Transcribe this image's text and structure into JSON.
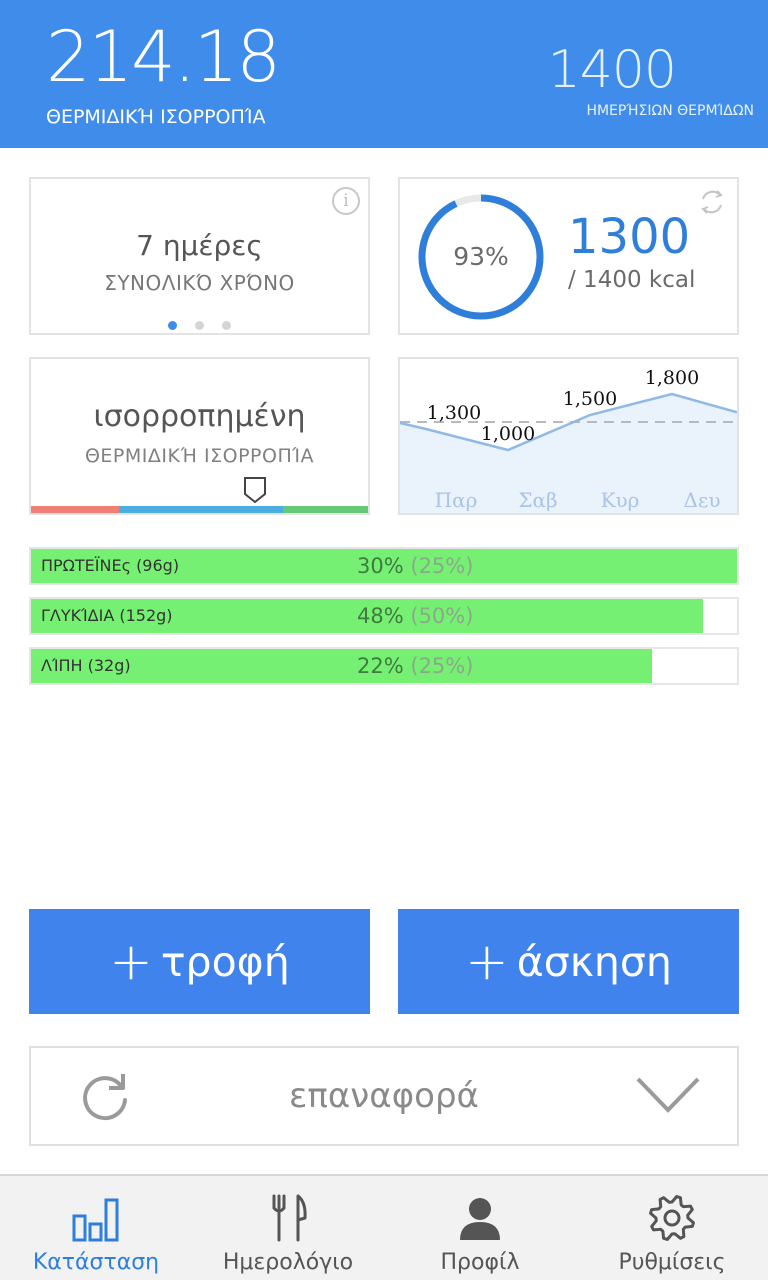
{
  "header": {
    "balance_value": "214.18",
    "balance_label": "ΘΕΡΜΙΔΙΚΉ ΙΣΟΡΡΟΠΊΑ",
    "daily_value": "1400",
    "daily_label": "ΗΜΕΡΉΣΙΩΝ ΘΕΡΜΊΔΩΝ"
  },
  "days_card": {
    "value": "7 ημέρες",
    "label": "ΣΥΝΟΛΙΚΌ ΧΡΌΝΟ",
    "info_icon": "info-icon",
    "page_count": 3,
    "active_page": 0
  },
  "calorie_card": {
    "percent_label": "93%",
    "percent": 0.93,
    "value": "1300",
    "goal": "/ 1400 kcal",
    "sync_icon": "sync-icon",
    "ring_color": "#2f7fda"
  },
  "status_card": {
    "value": "ισορροπημένη",
    "label": "ΘΕΡΜΙΔΙΚΉ ΙΣΟΡΡΟΠΊΑ",
    "scale_colors": [
      "#ef7f72",
      "#4aaee3",
      "#66c777"
    ],
    "marker_position": 0.66
  },
  "chart_data": {
    "type": "line",
    "categories": [
      "Παρ",
      "Σαβ",
      "Κυρ",
      "Δευ"
    ],
    "values": [
      1300,
      1000,
      1500,
      1800
    ],
    "data_labels": [
      "1,300",
      "1,000",
      "1,500",
      "1,800"
    ],
    "reference_value": 1400,
    "line_color": "#8fb9e6",
    "fill_color": "#eaf2fc"
  },
  "macros": [
    {
      "label": "ΠΡΩΤΕΪΝΕς (96g)",
      "percent": "30%",
      "target": "(25%)",
      "fill": 1.0
    },
    {
      "label": "ΓΛΥΚΊΔΙΑ (152g)",
      "percent": "48%",
      "target": "(50%)",
      "fill": 0.952
    },
    {
      "label": "ΛΊΠΗ (32g)",
      "percent": "22%",
      "target": "(25%)",
      "fill": 0.88
    }
  ],
  "actions": {
    "food_label": "τροφή",
    "exercise_label": "άσκηση",
    "plus_symbol": "+"
  },
  "reset": {
    "label": "επαναφορά",
    "refresh_icon": "refresh-icon",
    "expand_icon": "chevron-down-icon"
  },
  "nav": {
    "items": [
      {
        "label": "Κατάσταση",
        "icon": "bar-chart-icon",
        "active": true
      },
      {
        "label": "Ημερολόγιο",
        "icon": "fork-knife-icon",
        "active": false
      },
      {
        "label": "Προφίλ",
        "icon": "person-icon",
        "active": false
      },
      {
        "label": "Ρυθμίσεις",
        "icon": "gear-icon",
        "active": false
      }
    ],
    "active_color": "#2e7fdc"
  },
  "colors": {
    "header": "#3f8ceb",
    "button": "#4083ed",
    "macro_fill": "#76f073"
  }
}
